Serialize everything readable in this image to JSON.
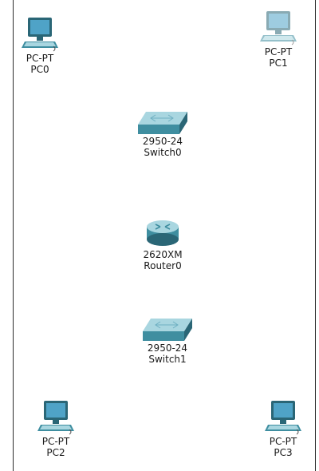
{
  "devices": [
    {
      "id": "pc0",
      "type": "pc",
      "model": "PC-PT",
      "name": "PC0",
      "icon": "pc-icon"
    },
    {
      "id": "pc1",
      "type": "pc",
      "model": "PC-PT",
      "name": "PC1",
      "icon": "pc-icon"
    },
    {
      "id": "switch0",
      "type": "switch",
      "model": "2950-24",
      "name": "Switch0",
      "icon": "switch-icon"
    },
    {
      "id": "router0",
      "type": "router",
      "model": "2620XM",
      "name": "Router0",
      "icon": "router-icon"
    },
    {
      "id": "switch1",
      "type": "switch",
      "model": "2950-24",
      "name": "Switch1",
      "icon": "switch-icon"
    },
    {
      "id": "pc2",
      "type": "pc",
      "model": "PC-PT",
      "name": "PC2",
      "icon": "pc-icon"
    },
    {
      "id": "pc3",
      "type": "pc",
      "model": "PC-PT",
      "name": "PC3",
      "icon": "pc-icon"
    }
  ],
  "colors": {
    "device_teal": "#3f8ea0",
    "device_light": "#a9d6e0",
    "device_dark": "#2a6676",
    "pc_screen": "#4fa3c7",
    "pc1_faded": "#9cc4d2"
  }
}
